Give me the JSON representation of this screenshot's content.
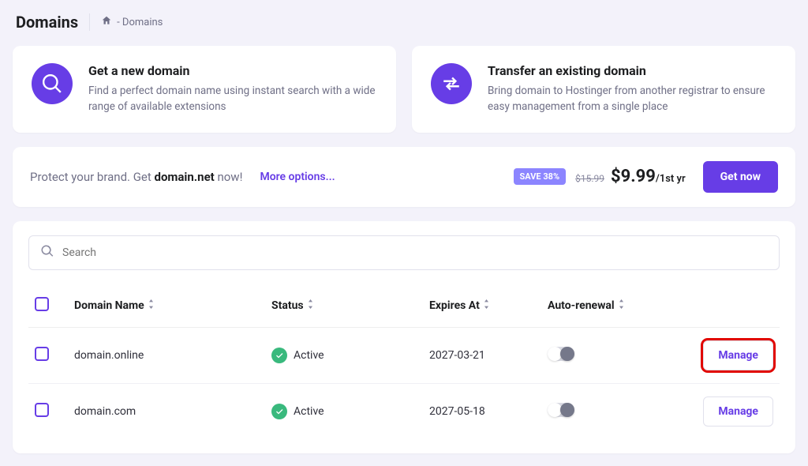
{
  "header": {
    "title": "Domains",
    "breadcrumb": "- Domains"
  },
  "cards": {
    "new": {
      "title": "Get a new domain",
      "sub": "Find a perfect domain name using instant search with a wide range of available extensions"
    },
    "transfer": {
      "title": "Transfer an existing domain",
      "sub": "Bring domain to Hostinger from another registrar to ensure easy management from a single place"
    }
  },
  "promo": {
    "prefix": "Protect your brand. Get ",
    "domain": "domain.net",
    "suffix": " now!",
    "more": "More options...",
    "badge": "SAVE 38%",
    "old_price": "$15.99",
    "price": "$9.99",
    "unit": "/1st yr",
    "cta": "Get now"
  },
  "search": {
    "placeholder": "Search"
  },
  "table": {
    "headers": {
      "name": "Domain Name",
      "status": "Status",
      "expires": "Expires At",
      "auto": "Auto-renewal"
    },
    "rows": [
      {
        "name": "domain.online",
        "status": "Active",
        "expires": "2027-03-21",
        "manage": "Manage",
        "highlight": true
      },
      {
        "name": "domain.com",
        "status": "Active",
        "expires": "2027-05-18",
        "manage": "Manage",
        "highlight": false
      }
    ]
  }
}
